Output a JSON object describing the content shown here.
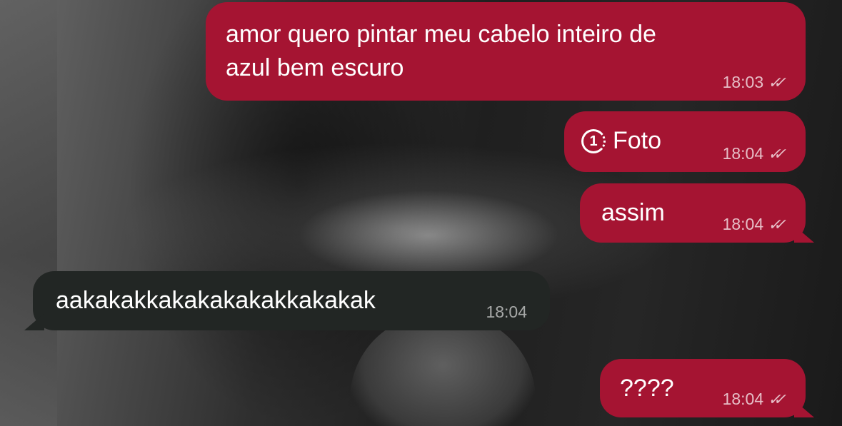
{
  "messages": [
    {
      "direction": "outgoing",
      "lines": [
        "amor quero pintar meu cabelo inteiro de",
        "azul bem escuro"
      ],
      "time": "18:03",
      "status": "read-double-check"
    },
    {
      "direction": "outgoing",
      "type": "view-once-photo",
      "icon_glyph": "1",
      "text": "Foto",
      "time": "18:04",
      "status": "read-double-check"
    },
    {
      "direction": "outgoing",
      "text": "assim",
      "time": "18:04",
      "status": "read-double-check"
    },
    {
      "direction": "incoming",
      "text": "aakakakkakakakakakkakakak",
      "time": "18:04"
    },
    {
      "direction": "outgoing",
      "text": "????",
      "time": "18:04",
      "status": "read-double-check"
    }
  ],
  "ticks_glyph": "✓✓",
  "colors": {
    "outgoing_bubble": "#a51432",
    "incoming_bubble": "#222624",
    "text": "#ffffff"
  }
}
